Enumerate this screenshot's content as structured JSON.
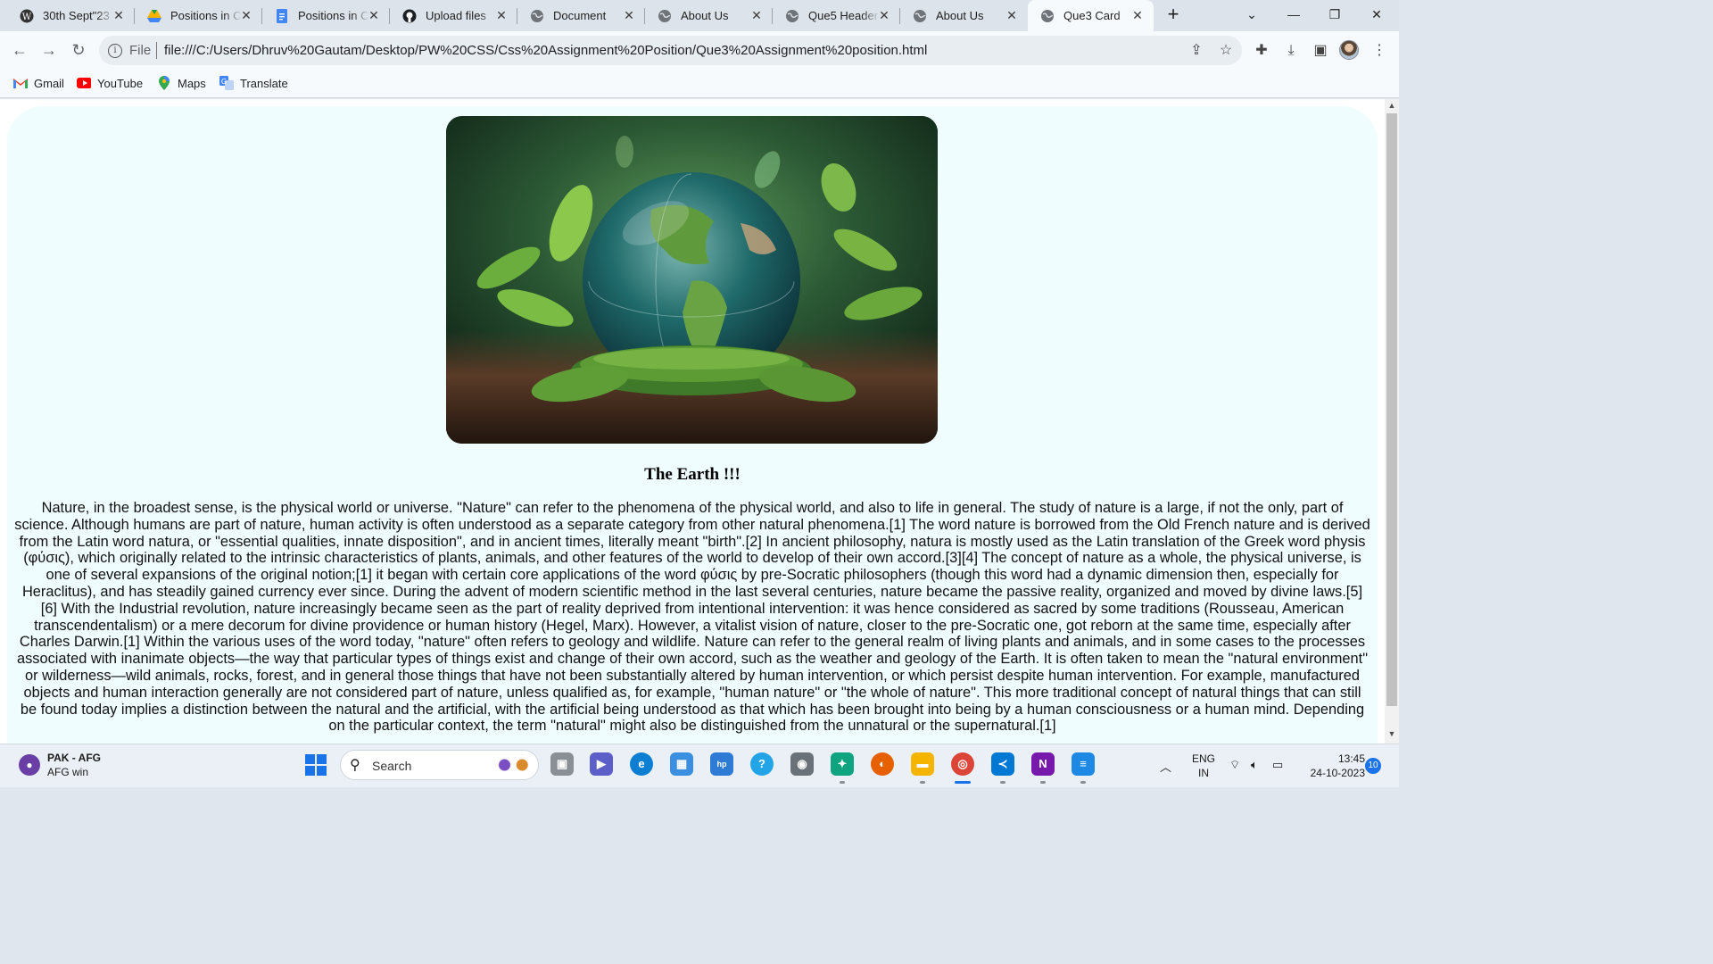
{
  "browser": {
    "tabs": [
      {
        "title": "30th Sept\"23",
        "icon": "wordpress-icon"
      },
      {
        "title": "Positions in C",
        "icon": "google-drive-icon"
      },
      {
        "title": "Positions in C",
        "icon": "google-docs-icon"
      },
      {
        "title": "Upload files",
        "icon": "github-icon"
      },
      {
        "title": "Document",
        "icon": "globe-icon"
      },
      {
        "title": "About Us",
        "icon": "globe-icon"
      },
      {
        "title": "Que5 Header",
        "icon": "globe-icon"
      },
      {
        "title": "About Us",
        "icon": "globe-icon"
      },
      {
        "title": "Que3 Card",
        "icon": "globe-icon",
        "active": true
      }
    ],
    "address": {
      "scheme_label": "File",
      "url": "file:///C:/Users/Dhruv%20Gautam/Desktop/PW%20CSS/Css%20Assignment%20Position/Que3%20Assignment%20position.html"
    },
    "bookmarks": [
      {
        "label": "Gmail",
        "icon": "gmail-icon"
      },
      {
        "label": "YouTube",
        "icon": "youtube-icon"
      },
      {
        "label": "Maps",
        "icon": "maps-icon"
      },
      {
        "label": "Translate",
        "icon": "translate-icon"
      }
    ]
  },
  "page": {
    "card": {
      "title": "The Earth !!!",
      "body": "Nature, in the broadest sense, is the physical world or universe. \"Nature\" can refer to the phenomena of the physical world, and also to life in general. The study of nature is a large, if not the only, part of science. Although humans are part of nature, human activity is often understood as a separate category from other natural phenomena.[1] The word nature is borrowed from the Old French nature and is derived from the Latin word natura, or \"essential qualities, innate disposition\", and in ancient times, literally meant \"birth\".[2] In ancient philosophy, natura is mostly used as the Latin translation of the Greek word physis (φύσις), which originally related to the intrinsic characteristics of plants, animals, and other features of the world to develop of their own accord.[3][4] The concept of nature as a whole, the physical universe, is one of several expansions of the original notion;[1] it began with certain core applications of the word φύσις by pre-Socratic philosophers (though this word had a dynamic dimension then, especially for Heraclitus), and has steadily gained currency ever since. During the advent of modern scientific method in the last several centuries, nature became the passive reality, organized and moved by divine laws.[5][6] With the Industrial revolution, nature increasingly became seen as the part of reality deprived from intentional intervention: it was hence considered as sacred by some traditions (Rousseau, American transcendentalism) or a mere decorum for divine providence or human history (Hegel, Marx). However, a vitalist vision of nature, closer to the pre-Socratic one, got reborn at the same time, especially after Charles Darwin.[1] Within the various uses of the word today, \"nature\" often refers to geology and wildlife. Nature can refer to the general realm of living plants and animals, and in some cases to the processes associated with inanimate objects—the way that particular types of things exist and change of their own accord, such as the weather and geology of the Earth. It is often taken to mean the \"natural environment\" or wilderness—wild animals, rocks, forest, and in general those things that have not been substantially altered by human intervention, or which persist despite human intervention. For example, manufactured objects and human interaction generally are not considered part of nature, unless qualified as, for example, \"human nature\" or \"the whole of nature\". This more traditional concept of natural things that can still be found today implies a distinction between the natural and the artificial, with the artificial being understood as that which has been brought into being by a human consciousness or a human mind. Depending on the particular context, the term \"natural\" might also be distinguished from the unnatural or the supernatural.[1]",
      "image": "earth-globe-in-plants-image"
    }
  },
  "taskbar": {
    "weather": {
      "title": "PAK - AFG",
      "subtitle": "AFG win"
    },
    "search_placeholder": "Search",
    "tray": {
      "language": "ENG",
      "region": "IN"
    },
    "clock": {
      "time": "13:45",
      "date": "24-10-2023"
    },
    "notification_count": "10"
  },
  "colors": {
    "card_background": "#effdff",
    "chrome_frame": "#dde3ea",
    "accent": "#1a73e8"
  }
}
